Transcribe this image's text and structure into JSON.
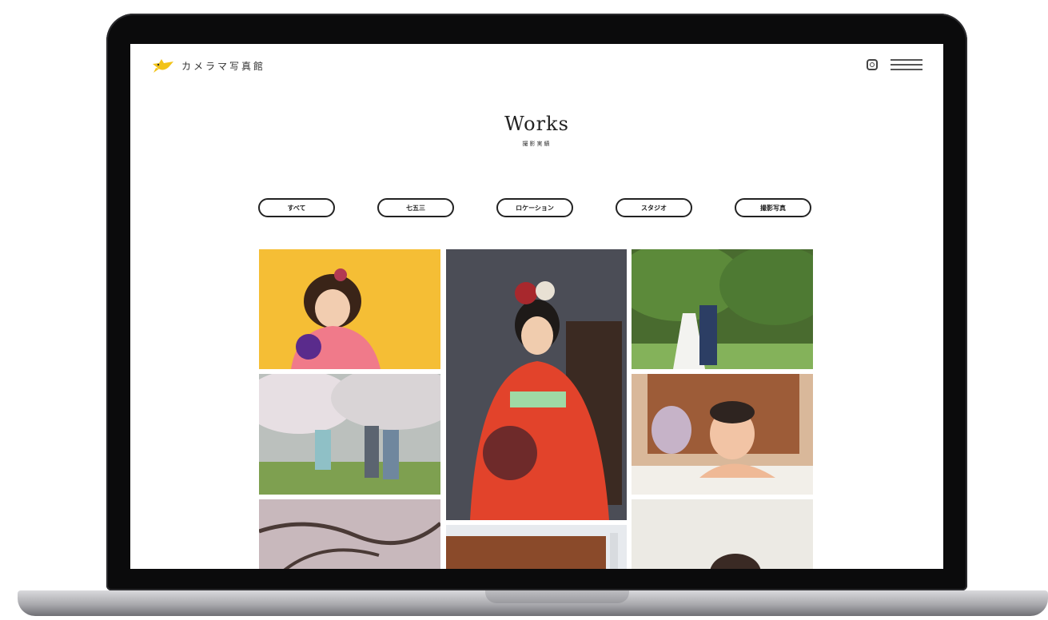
{
  "site": {
    "logo_text": "カメラマ写真館"
  },
  "page": {
    "title": "Works",
    "subtitle": "撮影実績"
  },
  "filters": [
    {
      "label": "すべて"
    },
    {
      "label": "七五三"
    },
    {
      "label": "ロケーション"
    },
    {
      "label": "スタジオ"
    },
    {
      "label": "撮影写真"
    }
  ],
  "icons": {
    "logo": "bird-icon",
    "social": "instagram-icon",
    "menu": "hamburger-menu-icon"
  },
  "colors": {
    "logo_bird": "#f2c318",
    "text": "#222222",
    "laptop_frame": "#0b0b0c"
  }
}
